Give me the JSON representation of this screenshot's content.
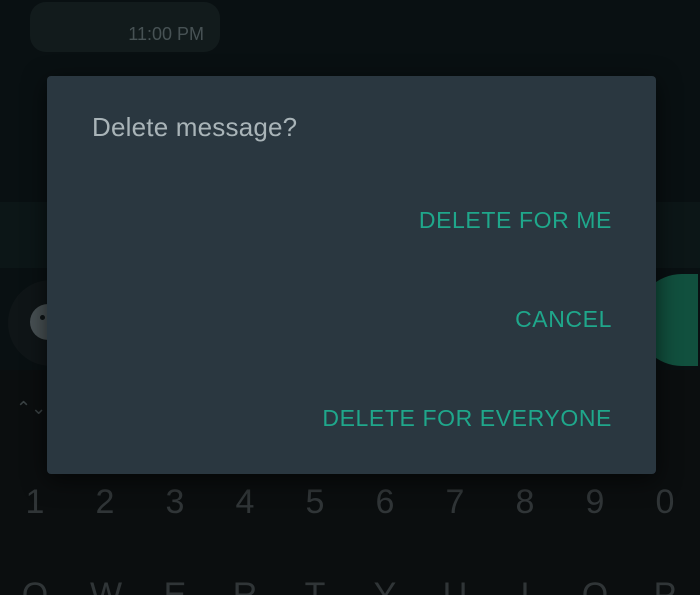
{
  "chat": {
    "message_time": "11:00 PM"
  },
  "dialog": {
    "title": "Delete message?",
    "actions": {
      "delete_for_me": "DELETE FOR ME",
      "cancel": "CANCEL",
      "delete_for_everyone": "DELETE FOR EVERYONE"
    }
  },
  "keyboard": {
    "number_row": [
      "1",
      "2",
      "3",
      "4",
      "5",
      "6",
      "7",
      "8",
      "9",
      "0"
    ],
    "letter_row": [
      "Q",
      "W",
      "E",
      "R",
      "T",
      "Y",
      "U",
      "I",
      "O",
      "P"
    ],
    "toggle_icon": "⌃⌄"
  },
  "colors": {
    "dialog_background": "#2a3740",
    "accent": "#1fa78b",
    "title_text": "#a9b4b8"
  },
  "icons": {
    "emoji": "emoji-icon",
    "mic": "mic-icon",
    "keyboard_toggle": "expand-collapse-icon"
  }
}
